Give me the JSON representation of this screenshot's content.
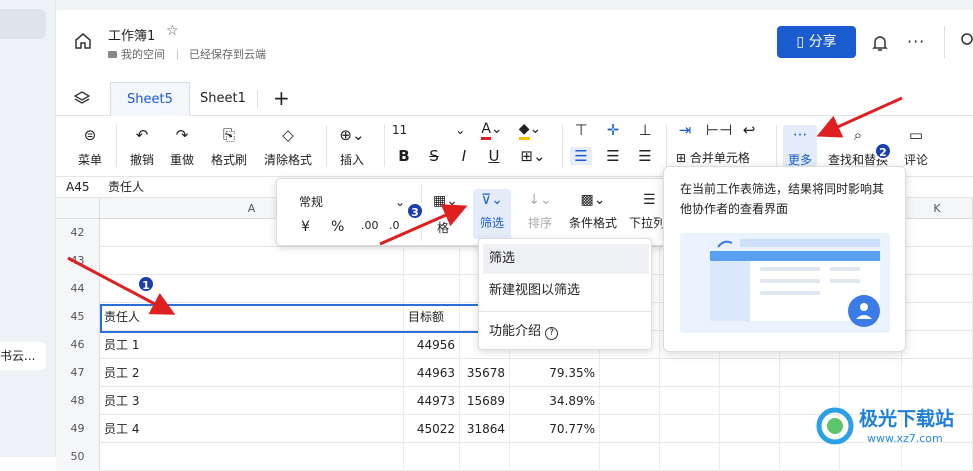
{
  "left_panel": {
    "truncated_text": "书云..."
  },
  "header": {
    "doc_title": "工作簿1",
    "location": "我的空间",
    "save_status": "已经保存到云端",
    "share_label": "分享"
  },
  "tabs": [
    "Sheet5",
    "Sheet1"
  ],
  "toolbar": {
    "menu": "菜单",
    "undo": "撤销",
    "redo": "重做",
    "format_painter": "格式刷",
    "clear_format": "清除格式",
    "insert": "插入",
    "font_size": "11",
    "merge": "合并单元格",
    "more": "更多",
    "find_replace": "查找和替换",
    "comment": "评论"
  },
  "formula_bar": {
    "cell_ref": "A45",
    "content": "责任人"
  },
  "format_popup": {
    "number_format": "常规",
    "percent": "%",
    "filter": "筛选",
    "sort": "排序",
    "cond_format": "条件格式",
    "dropdown": "下拉列表",
    "wrap_partial": "格"
  },
  "filter_menu": {
    "items": [
      "筛选",
      "新建视图以筛选",
      "功能介绍"
    ]
  },
  "tooltip": {
    "text": "在当前工作表筛选，结果将同时影响其他协作者的查看界面"
  },
  "grid": {
    "columns": [
      "A",
      "K"
    ],
    "rows": [
      {
        "n": "42",
        "a": "",
        "b": "",
        "c": "",
        "d": ""
      },
      {
        "n": "43",
        "a": "",
        "b": "",
        "c": "",
        "d": ""
      },
      {
        "n": "44",
        "a": "",
        "b": "",
        "c": "",
        "d": ""
      },
      {
        "n": "45",
        "a": "责任人",
        "b": "目标额",
        "c": "营",
        "d": ""
      },
      {
        "n": "46",
        "a": "员工 1",
        "b": "44956",
        "c": "",
        "d": ""
      },
      {
        "n": "47",
        "a": "员工 2",
        "b": "44963",
        "c": "35678",
        "d": "79.35%"
      },
      {
        "n": "48",
        "a": "员工 3",
        "b": "44973",
        "c": "15689",
        "d": "34.89%"
      },
      {
        "n": "49",
        "a": "员工 4",
        "b": "45022",
        "c": "31864",
        "d": "70.77%"
      },
      {
        "n": "50",
        "a": "",
        "b": "",
        "c": "",
        "d": ""
      }
    ]
  },
  "badges": [
    "1",
    "2",
    "3"
  ],
  "watermark": {
    "name": "极光下载站",
    "url": "www.xz7.com"
  },
  "colors": {
    "accent": "#1a5ccf",
    "arrow": "#e02020",
    "badge": "#1a3fb0"
  }
}
